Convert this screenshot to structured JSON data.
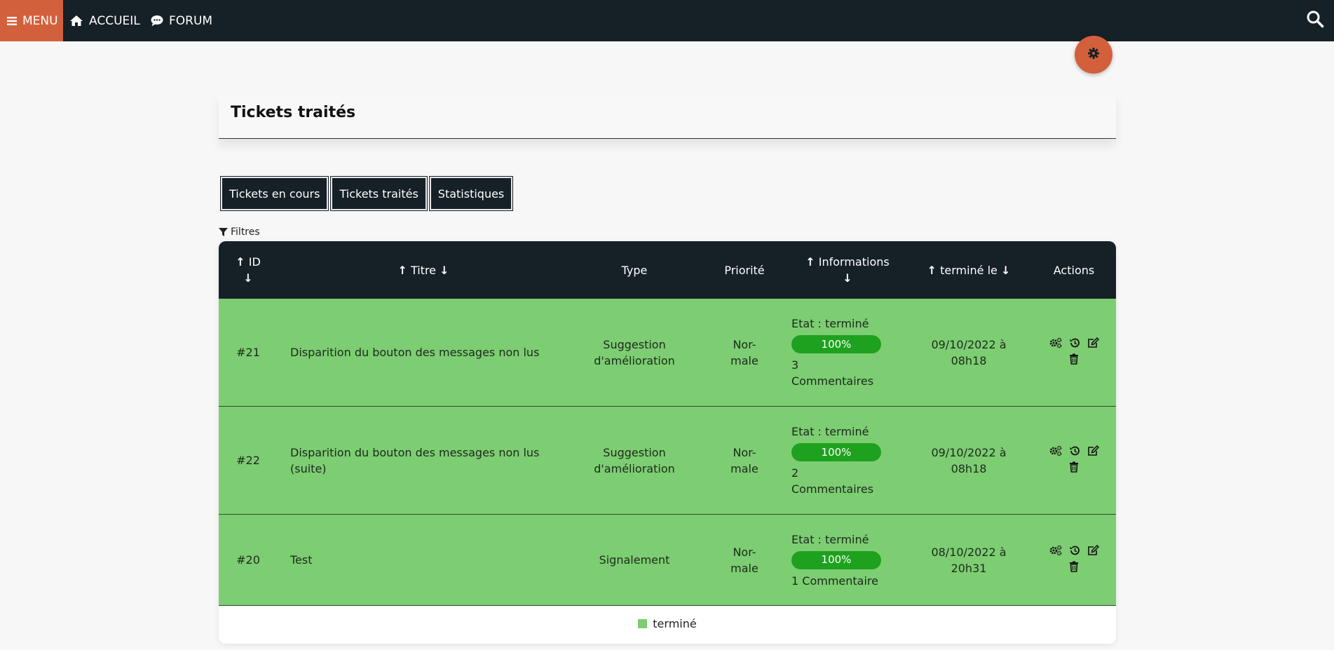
{
  "nav": {
    "menu_label": "MENU",
    "home_label": "ACCUEIL",
    "forum_label": "FORUM",
    "icons": {
      "menu": "bars-icon",
      "home": "home-icon",
      "forum": "comment-icon",
      "search": "search-icon"
    }
  },
  "colors": {
    "accent": "#d3603c",
    "navbar": "#162027",
    "row_done": "#7dcd72",
    "progress": "#1ea11e"
  },
  "page": {
    "title": "Tickets traités"
  },
  "tabs": [
    {
      "label": "Tickets en cours"
    },
    {
      "label": "Tickets traités"
    },
    {
      "label": "Statistiques"
    }
  ],
  "filters": {
    "label": "Filtres"
  },
  "table": {
    "headers": {
      "id": "ID",
      "title": "Titre",
      "type": "Type",
      "priority": "Priorité",
      "info": "Informations",
      "finished": "terminé le",
      "actions": "Actions"
    },
    "rows": [
      {
        "id": "#21",
        "title": "Disparition du bouton des messages non lus",
        "type_line1": "Suggestion",
        "type_line2": "d'amélioration",
        "priority_line1": "Nor-",
        "priority_line2": "male",
        "state": "Etat : terminé",
        "progress": "100%",
        "comments_line1": "3",
        "comments_line2": "Commentaires",
        "date_line1": "09/10/2022 à",
        "date_line2": "08h18"
      },
      {
        "id": "#22",
        "title_line1": "Disparition du bouton des messages non lus",
        "title_line2": "(suite)",
        "type_line1": "Suggestion",
        "type_line2": "d'amélioration",
        "priority_line1": "Nor-",
        "priority_line2": "male",
        "state": "Etat : terminé",
        "progress": "100%",
        "comments_line1": "2",
        "comments_line2": "Commentaires",
        "date_line1": "09/10/2022 à",
        "date_line2": "08h18"
      },
      {
        "id": "#20",
        "title": "Test",
        "type": "Signalement",
        "priority_line1": "Nor-",
        "priority_line2": "male",
        "state": "Etat : terminé",
        "progress": "100%",
        "comments": "1 Commentaire",
        "date_line1": "08/10/2022 à",
        "date_line2": "20h31"
      }
    ]
  },
  "legend": {
    "label": "terminé"
  }
}
